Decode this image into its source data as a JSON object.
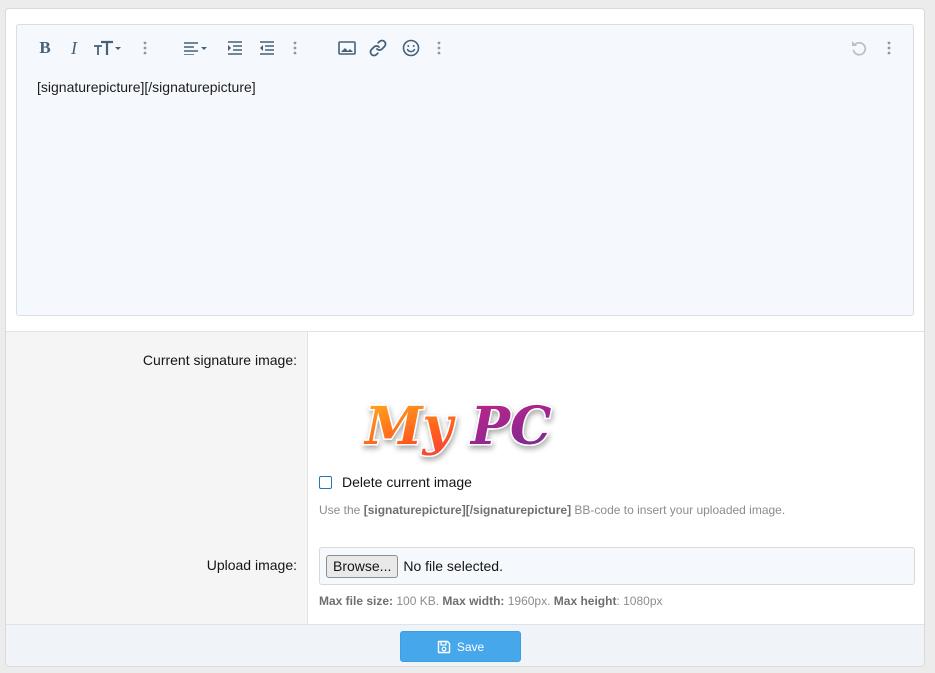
{
  "editor": {
    "content": "[signaturepicture][/signaturepicture]",
    "toolbar": {
      "bold_label": "B",
      "italic_label": "I"
    }
  },
  "form": {
    "current_label": "Current signature image:",
    "upload_label": "Upload image:",
    "signature_logo_text": "My PC",
    "delete_label": "Delete current image",
    "hint_prefix": "Use the ",
    "hint_code": "[signaturepicture][/signaturepicture]",
    "hint_suffix": " BB-code to insert your uploaded image.",
    "browse_label": "Browse...",
    "file_status": "No file selected.",
    "limits": {
      "size_label": "Max file size:",
      "size_value": " 100 KB. ",
      "width_label": "Max width:",
      "width_value": " 1960px. ",
      "height_label": "Max height",
      "height_value": ": 1080px"
    }
  },
  "footer": {
    "save_label": "Save"
  },
  "colors": {
    "accent": "#47a7eb",
    "toolbar_icon": "#47607a",
    "editor_bg": "#f5f9fd"
  }
}
